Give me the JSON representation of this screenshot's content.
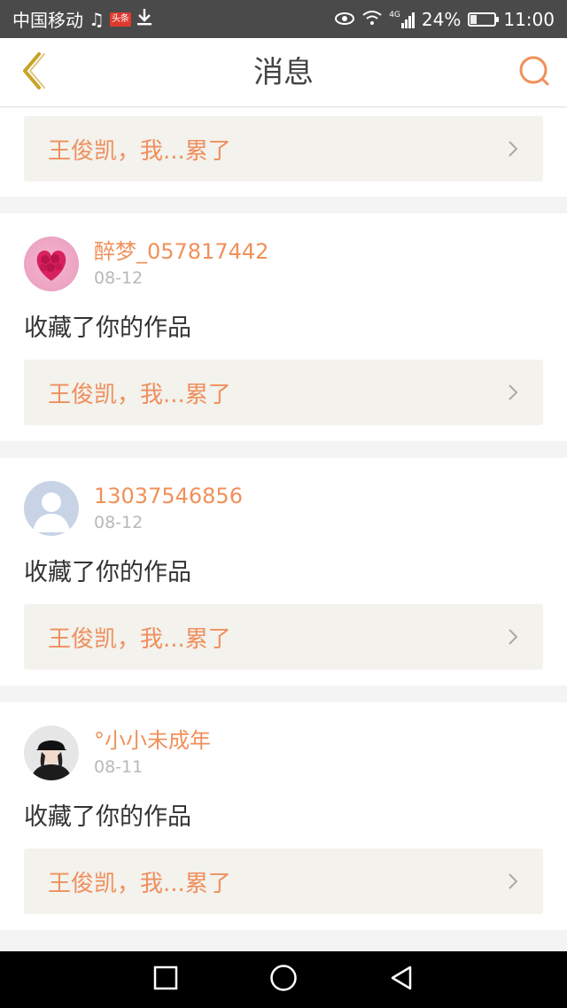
{
  "status_bar": {
    "carrier": "中国移动",
    "news_badge": "头条",
    "network": "4G",
    "battery": "24%",
    "battery_level": 0.24,
    "time": "11:00"
  },
  "header": {
    "title": "消息",
    "back_icon": "chevron-left-icon",
    "search_icon": "search-icon"
  },
  "colors": {
    "accent": "#f0905a",
    "back_icon": "#c9a227",
    "work_box_bg": "#f3f2ec"
  },
  "top_item": {
    "work_title": "王俊凯，我...累了"
  },
  "messages": [
    {
      "username": "醉梦_057817442",
      "date": "08-12",
      "action": "收藏了你的作品",
      "work_title": "王俊凯，我...累了",
      "avatar": "rose-heart-avatar"
    },
    {
      "username": "13037546856",
      "date": "08-12",
      "action": "收藏了你的作品",
      "work_title": "王俊凯，我...累了",
      "avatar": "default-person-avatar"
    },
    {
      "username": "°小小未成年",
      "date": "08-11",
      "action": "收藏了你的作品",
      "work_title": "王俊凯，我...累了",
      "avatar": "girl-cap-avatar"
    }
  ],
  "nav_bar": {
    "items": [
      "recent-apps-icon",
      "home-icon",
      "back-triangle-icon"
    ]
  }
}
